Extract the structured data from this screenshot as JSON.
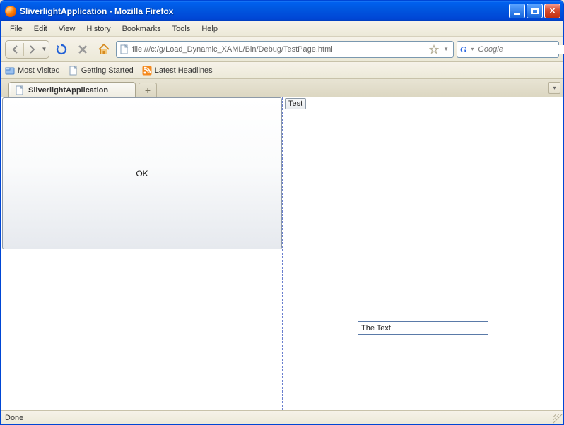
{
  "window": {
    "title": "SliverlightApplication - Mozilla Firefox"
  },
  "menu": {
    "file": "File",
    "edit": "Edit",
    "view": "View",
    "history": "History",
    "bookmarks": "Bookmarks",
    "tools": "Tools",
    "help": "Help"
  },
  "toolbar": {
    "url": "file:///c:/g/Load_Dynamic_XAML/Bin/Debug/TestPage.html",
    "search_placeholder": "Google"
  },
  "bookmarks": {
    "most_visited": "Most Visited",
    "getting_started": "Getting Started",
    "latest_headlines": "Latest Headlines"
  },
  "tabs": {
    "active": "SliverlightApplication"
  },
  "content": {
    "ok_button": "OK",
    "test_button": "Test",
    "textbox_value": "The Text"
  },
  "status": {
    "text": "Done"
  }
}
